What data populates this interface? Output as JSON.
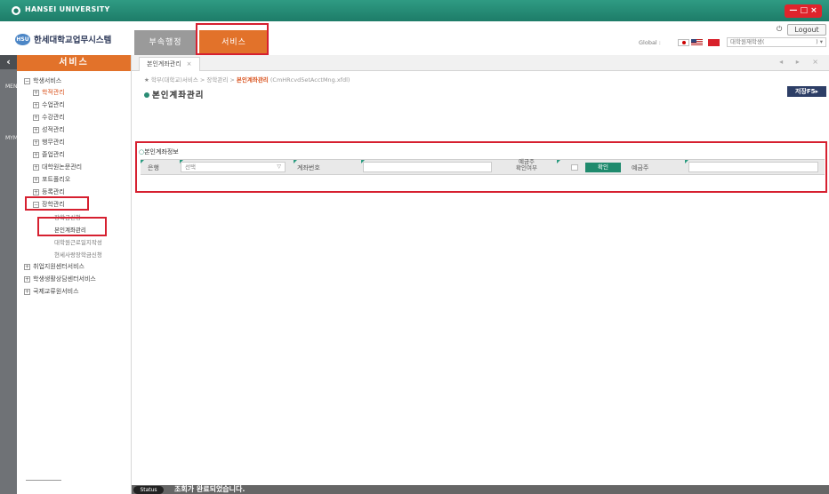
{
  "titlebar": {
    "app_name": "HANSEI UNIVERSITY",
    "window_controls": "— □ ×"
  },
  "header": {
    "brand": "한세대학교업무시스템",
    "brand_mark": "HSU",
    "tabs": [
      {
        "label": "부속행정"
      },
      {
        "label": "서비스"
      }
    ],
    "logout_label": "Logout",
    "global_label": "Global :",
    "user_select_text": "대학원재학생(",
    "user_select_tail": ") ▾"
  },
  "leftbar": {
    "top_label": "MENU",
    "bottom_label": "MYMENU"
  },
  "sidebar": {
    "title": "서비스",
    "tree": [
      {
        "box": "−",
        "label": "학생서비스"
      },
      {
        "box": "+",
        "label": "학적관리"
      },
      {
        "box": "+",
        "label": "수업관리"
      },
      {
        "box": "+",
        "label": "수강관리"
      },
      {
        "box": "+",
        "label": "성적관리"
      },
      {
        "box": "+",
        "label": "행무관리"
      },
      {
        "box": "+",
        "label": "졸업관리"
      },
      {
        "box": "+",
        "label": "대학원논문관리"
      },
      {
        "box": "+",
        "label": "포트폴리오"
      },
      {
        "box": "+",
        "label": "등록관리"
      },
      {
        "box": "−",
        "label": "장학관리"
      },
      {
        "label": "장학금신청"
      },
      {
        "label": "본인계좌관리"
      },
      {
        "label": "대학원근로일지작성"
      },
      {
        "label": "현세사랑장학금신청"
      },
      {
        "box": "+",
        "label": "취업지원센터서비스"
      },
      {
        "box": "+",
        "label": "학생생활상담센터서비스"
      },
      {
        "box": "+",
        "label": "국제교류원서비스"
      }
    ]
  },
  "content": {
    "tab_label": "본인계좌관리",
    "tab_close": "×",
    "tab_nav": "◂ ▸ ×",
    "breadcrumb": {
      "star": "★",
      "path": "학부(대학교)서비스 > 장학관리 > ",
      "current": "본인계좌관리",
      "code": "(CmHRcvd5etAcctMng.xfdl)"
    },
    "page_title": "본인계좌관리",
    "save_label": "저장F5▸",
    "section_title": "본인계좌정보",
    "form": {
      "bank_label": "은행",
      "bank_value": "선택",
      "account_label": "계좌번호",
      "holder_check_label_1": "예금주",
      "holder_check_label_2": "확인여부",
      "confirm_label": "확인",
      "holder_label": "예금주"
    }
  },
  "status": {
    "pill": "Status",
    "message": "조회가 완료되었습니다."
  },
  "colors": {
    "accent_orange": "#e2722a",
    "teal": "#1f8a6d",
    "highlight_red": "#d62030",
    "navy": "#2d3e66"
  }
}
